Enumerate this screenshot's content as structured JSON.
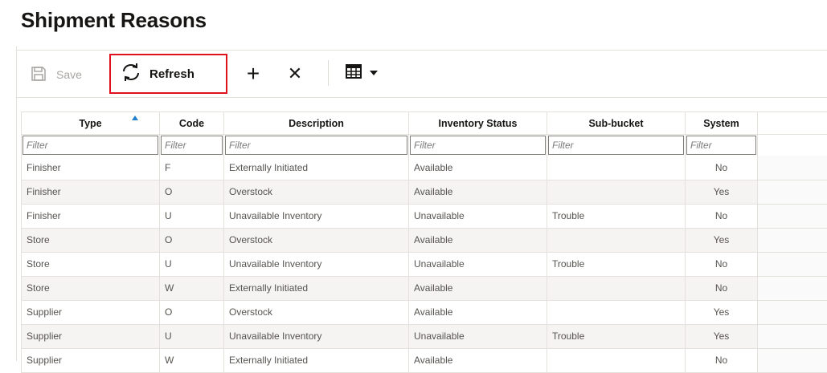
{
  "page": {
    "title": "Shipment Reasons"
  },
  "toolbar": {
    "save_label": "Save",
    "refresh_label": "Refresh",
    "add_symbol": "+",
    "delete_symbol": "✕",
    "highlight_color": "#e0121e"
  },
  "table": {
    "columns": [
      "Type",
      "Code",
      "Description",
      "Inventory Status",
      "Sub-bucket",
      "System"
    ],
    "sorted_column": "Type",
    "sort_direction": "ascending",
    "filter_placeholder": "Filter",
    "rows": [
      [
        "Finisher",
        "F",
        "Externally Initiated",
        "Available",
        "",
        "No"
      ],
      [
        "Finisher",
        "O",
        "Overstock",
        "Available",
        "",
        "Yes"
      ],
      [
        "Finisher",
        "U",
        "Unavailable Inventory",
        "Unavailable",
        "Trouble",
        "No"
      ],
      [
        "Store",
        "O",
        "Overstock",
        "Available",
        "",
        "Yes"
      ],
      [
        "Store",
        "U",
        "Unavailable Inventory",
        "Unavailable",
        "Trouble",
        "No"
      ],
      [
        "Store",
        "W",
        "Externally Initiated",
        "Available",
        "",
        "No"
      ],
      [
        "Supplier",
        "O",
        "Overstock",
        "Available",
        "",
        "Yes"
      ],
      [
        "Supplier",
        "U",
        "Unavailable Inventory",
        "Unavailable",
        "Trouble",
        "Yes"
      ],
      [
        "Supplier",
        "W",
        "Externally Initiated",
        "Available",
        "",
        "No"
      ]
    ]
  }
}
